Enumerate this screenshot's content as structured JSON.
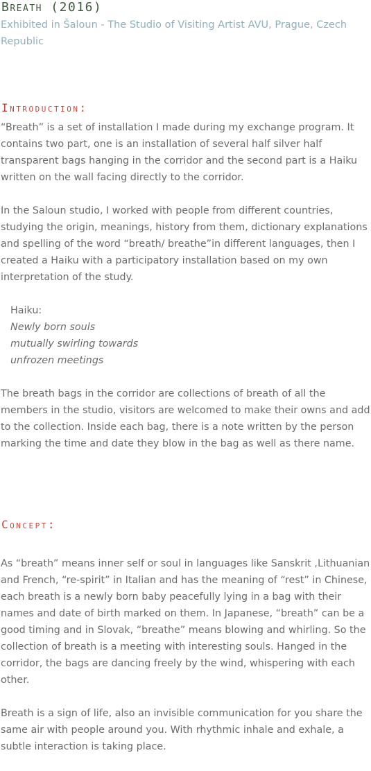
{
  "header": {
    "title": "Breath (2016)",
    "subtitle": "Exhibited in Šaloun - The Studio of Visiting Artist AVU, Prague, Czech Republic"
  },
  "introduction": {
    "heading": "Introduction:",
    "paragraphs": [
      "“Breath” is a set of installation I made during my exchange program. It contains two part, one is an installation of several half silver half transparent bags hanging in the corridor and the second part is a Haiku written on the wall facing directly to the corridor.",
      "In the Saloun studio, I worked with people from different countries, studying the origin, meanings, history from them, dictionary explanations and spelling of the word “breath/ breathe”in different languages, then I created a Haiku with a participatory installation based on my own interpretation of the study."
    ],
    "haiku": {
      "label": "Haiku:",
      "lines": [
        "Newly born souls",
        "mutually swirling towards",
        "unfrozen meetings"
      ]
    },
    "closing": "The breath bags in the corridor are collections of breath of all the members in the studio, visitors are welcomed to make their owns and add to the collection. Inside each bag, there is a note written by the person marking the time and date they blow in the bag as well as there name."
  },
  "concept": {
    "heading": "Concept:",
    "paragraphs": [
      "As “breath” means inner self or soul in languages like Sanskrit ,Lithuanian and French, “re-spirit” in Italian and has the meaning of “rest” in Chinese, each breath is a newly born baby peacefully lying in a bag with their names and date of birth marked on them. In Japanese, “breath” can be a good timing and in Slovak, “breathe” means blowing and whirling. So the collection of breath is a meeting with interesting souls. Hanged in the corridor, the bags are dancing freely by the wind, whispering with each other.",
      "Breath is a sign of life, also an invisible communication for you share the same air with people around you. With rhythmic inhale and exhale, a subtle interaction is taking place."
    ]
  }
}
